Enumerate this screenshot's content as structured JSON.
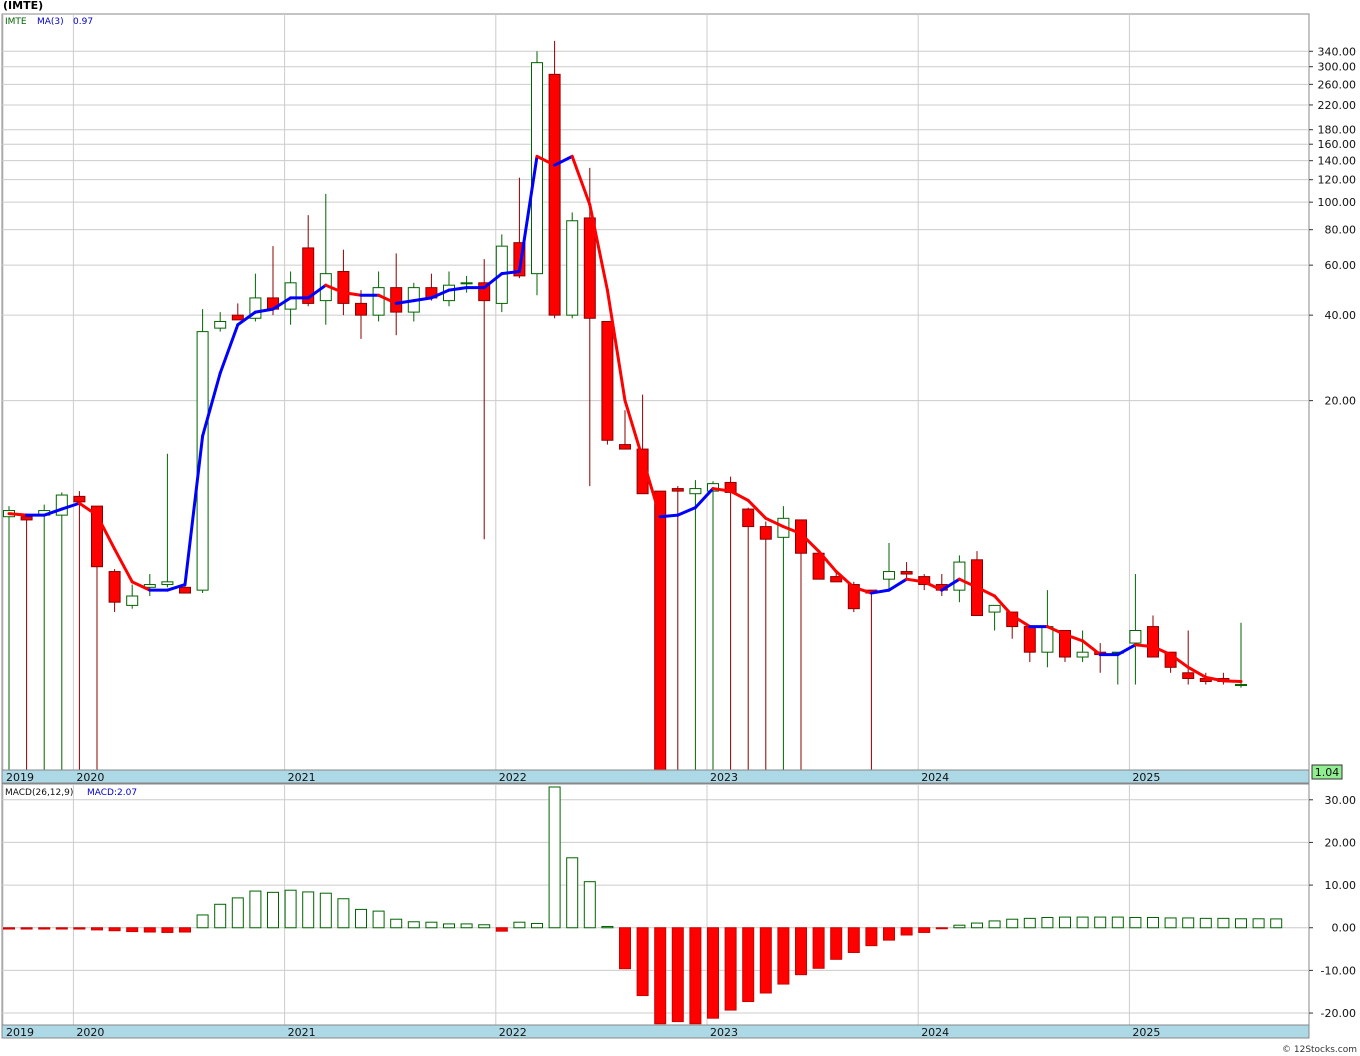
{
  "header": {
    "ticker_title": "(IMTE)",
    "ticker": "IMTE",
    "ma_label": "MA(3)",
    "ma_value": "0.97",
    "macd_label": "MACD(26,12,9)",
    "macd_value": "MACD:2.07",
    "last_price": "1.04",
    "watermark": "© 12Stocks.com"
  },
  "colors": {
    "up": "#006400",
    "down": "#ff0000",
    "ma_up": "#0000ff",
    "ma_down": "#ff0000",
    "axis_band": "#add8e6",
    "price_box": "#90ee90"
  },
  "chart_data": [
    {
      "type": "candlestick",
      "title": "(IMTE)",
      "scale": "log",
      "x_labels": [
        "2019",
        "2020",
        "2021",
        "2022",
        "2023",
        "2024",
        "2025"
      ],
      "y_ticks": [
        "340.00",
        "300.00",
        "260.00",
        "220.00",
        "180.00",
        "160.00",
        "140.00",
        "120.00",
        "100.00",
        "80.00",
        "60.00",
        "40.00",
        "20.00"
      ],
      "y_tick_values": [
        340,
        300,
        260,
        220,
        180,
        160,
        140,
        120,
        100,
        80,
        60,
        40,
        20
      ],
      "ylim": [
        1.0,
        460
      ],
      "grid": true,
      "series": [
        {
          "name": "IMTE",
          "ohlc": [
            [
              7.8,
              8.5,
              1,
              8.2
            ],
            [
              7.8,
              8.0,
              1,
              7.6
            ],
            [
              7.9,
              8.6,
              1,
              8.2
            ],
            [
              7.9,
              9.5,
              1,
              9.3
            ],
            [
              9.2,
              9.6,
              1,
              8.8
            ],
            [
              8.5,
              8.5,
              1,
              5.2
            ],
            [
              5.0,
              5.1,
              3.6,
              3.9
            ],
            [
              3.8,
              4.5,
              3.7,
              4.1
            ],
            [
              4.4,
              4.9,
              4.1,
              4.5
            ],
            [
              4.5,
              13.0,
              4.4,
              4.6
            ],
            [
              4.4,
              4.6,
              4.3,
              4.2
            ],
            [
              4.3,
              42,
              4.2,
              35
            ],
            [
              36,
              41,
              35,
              38
            ],
            [
              40,
              44,
              39,
              38.5
            ],
            [
              39,
              56,
              38,
              46
            ],
            [
              46,
              70,
              40,
              42
            ],
            [
              42,
              57,
              37,
              52
            ],
            [
              69,
              90,
              43,
              44
            ],
            [
              45,
              107,
              37,
              56
            ],
            [
              57,
              68,
              40,
              44
            ],
            [
              44,
              49,
              33,
              40
            ],
            [
              40,
              57,
              38,
              50
            ],
            [
              50,
              66,
              34,
              41
            ],
            [
              41,
              52,
              38,
              50
            ],
            [
              50,
              56,
              45,
              46
            ],
            [
              45,
              57,
              43,
              51
            ],
            [
              52,
              55,
              48,
              52
            ],
            [
              52,
              63,
              6.5,
              45
            ],
            [
              44,
              77,
              41,
              70
            ],
            [
              72,
              122,
              54,
              55
            ],
            [
              56,
              340,
              47,
              310
            ],
            [
              282,
              370,
              39,
              40
            ],
            [
              40,
              92,
              39,
              86
            ],
            [
              88,
              132,
              10,
              39
            ],
            [
              38,
              38,
              14,
              14.5
            ],
            [
              14,
              18.5,
              13.8,
              13.5
            ],
            [
              13.5,
              21,
              9.4,
              9.4
            ],
            [
              9.6,
              9.6,
              0.9,
              0.9
            ],
            [
              9.8,
              10,
              1,
              9.6
            ],
            [
              9.4,
              10.5,
              1,
              9.8
            ],
            [
              9.6,
              10.4,
              1,
              10.2
            ],
            [
              10.3,
              10.8,
              1,
              9.5
            ],
            [
              8.3,
              8.4,
              1,
              7.2
            ],
            [
              7.2,
              7.5,
              1,
              6.5
            ],
            [
              6.6,
              8.5,
              1,
              7.7
            ],
            [
              7.6,
              7.6,
              1,
              5.8
            ],
            [
              5.8,
              5.9,
              4.8,
              4.7
            ],
            [
              4.8,
              5.0,
              4.6,
              4.6
            ],
            [
              4.5,
              4.6,
              3.6,
              3.7
            ],
            [
              4.3,
              4.3,
              1,
              4.2
            ],
            [
              4.7,
              6.3,
              4.3,
              5.0
            ],
            [
              5.0,
              5.4,
              4.7,
              4.9
            ],
            [
              4.8,
              4.9,
              4.3,
              4.5
            ],
            [
              4.5,
              4.9,
              4.1,
              4.3
            ],
            [
              4.3,
              5.7,
              3.9,
              5.4
            ],
            [
              5.5,
              5.9,
              3.5,
              3.5
            ],
            [
              3.6,
              3.8,
              3.1,
              3.8
            ],
            [
              3.6,
              3.6,
              2.9,
              3.2
            ],
            [
              3.2,
              3.2,
              2.4,
              2.6
            ],
            [
              2.6,
              4.3,
              2.3,
              3.2
            ],
            [
              3.1,
              3.1,
              2.4,
              2.5
            ],
            [
              2.5,
              3.1,
              2.4,
              2.6
            ],
            [
              2.6,
              2.8,
              2.2,
              2.55
            ],
            [
              2.6,
              2.6,
              2.0,
              2.6
            ],
            [
              2.8,
              4.9,
              2.0,
              3.1
            ],
            [
              3.2,
              3.5,
              2.5,
              2.5
            ],
            [
              2.6,
              2.6,
              2.2,
              2.3
            ],
            [
              2.2,
              3.1,
              2.0,
              2.1
            ],
            [
              2.1,
              2.2,
              2.0,
              2.05
            ],
            [
              2.1,
              2.2,
              2.0,
              2.05
            ],
            [
              2.0,
              3.3,
              1.95,
              2.0
            ]
          ]
        },
        {
          "name": "MA(3)",
          "values": [
            8.0,
            7.9,
            7.9,
            8.3,
            8.7,
            7.9,
            6.0,
            4.6,
            4.3,
            4.3,
            4.5,
            15,
            25,
            37,
            41,
            42,
            46,
            46,
            51,
            48,
            47,
            47,
            44,
            45,
            46,
            49,
            50,
            50,
            56,
            57,
            145,
            135,
            145,
            98,
            49,
            20,
            12.5,
            7.8,
            7.9,
            8.4,
            9.8,
            9.6,
            8.9,
            7.7,
            7.2,
            6.8,
            5.9,
            5.0,
            4.4,
            4.2,
            4.3,
            4.7,
            4.6,
            4.3,
            4.7,
            4.4,
            4.1,
            3.5,
            3.2,
            3.2,
            3.0,
            2.85,
            2.55,
            2.55,
            2.76,
            2.72,
            2.55,
            2.3,
            2.12,
            2.06,
            2.05
          ]
        }
      ],
      "last_value": 1.04
    },
    {
      "type": "bar",
      "title": "MACD(26,12,9)",
      "y_ticks": [
        "30.00",
        "20.00",
        "10.00",
        "0.00",
        "-10.00",
        "-20.00"
      ],
      "y_tick_values": [
        30,
        20,
        10,
        0,
        -10,
        -20
      ],
      "ylim": [
        -22.8,
        33.7
      ],
      "x_labels": [
        "2019",
        "2020",
        "2021",
        "2022",
        "2023",
        "2024",
        "2025"
      ],
      "series": [
        {
          "name": "MACD:2.07",
          "values": [
            -0.3,
            -0.3,
            -0.3,
            -0.3,
            -0.3,
            -0.5,
            -0.7,
            -0.9,
            -1.0,
            -1.1,
            -1.0,
            3.0,
            5.5,
            7.0,
            8.6,
            8.3,
            8.8,
            8.4,
            8.1,
            6.8,
            4.3,
            3.9,
            2.0,
            1.4,
            1.3,
            0.9,
            0.9,
            0.7,
            -0.8,
            1.3,
            1.0,
            33.0,
            16.4,
            10.8,
            0.3,
            -9.6,
            -15.9,
            -22.5,
            -22.0,
            -22.5,
            -21.2,
            -19.3,
            -17.3,
            -15.3,
            -13.2,
            -11.0,
            -9.5,
            -7.4,
            -5.8,
            -4.2,
            -2.9,
            -1.7,
            -1.1,
            -0.2,
            0.6,
            1.1,
            1.6,
            2.0,
            2.2,
            2.4,
            2.5,
            2.5,
            2.5,
            2.5,
            2.4,
            2.4,
            2.3,
            2.3,
            2.2,
            2.2,
            2.1,
            2.1,
            2.07
          ]
        }
      ]
    }
  ]
}
